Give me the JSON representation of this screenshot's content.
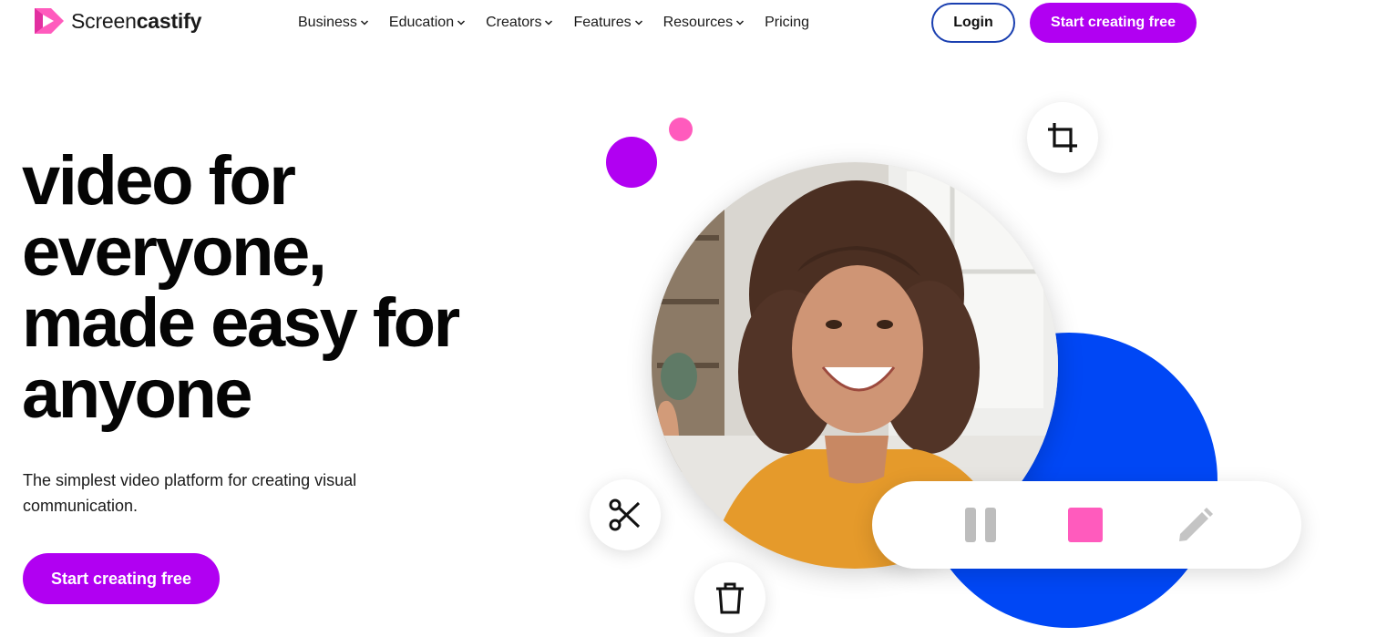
{
  "header": {
    "logo": {
      "text_light": "Screen",
      "text_bold": "castify"
    },
    "nav": [
      {
        "label": "Business",
        "has_dropdown": true
      },
      {
        "label": "Education",
        "has_dropdown": true
      },
      {
        "label": "Creators",
        "has_dropdown": true
      },
      {
        "label": "Features",
        "has_dropdown": true
      },
      {
        "label": "Resources",
        "has_dropdown": true
      },
      {
        "label": "Pricing",
        "has_dropdown": false
      }
    ],
    "login_label": "Login",
    "cta_label": "Start creating free"
  },
  "hero": {
    "headline_lines": [
      "video for",
      "everyone,",
      "made easy for",
      "anyone"
    ],
    "subtext": "The simplest video platform for creating visual communication.",
    "cta_label": "Start creating free"
  },
  "recorder": {
    "icons": [
      "crop-icon",
      "scissors-icon",
      "trash-icon",
      "pause-icon",
      "stop-icon",
      "pencil-icon"
    ]
  },
  "colors": {
    "brand_purple": "#b100f2",
    "accent_pink": "#ff5bbd",
    "accent_blue": "#0047f5",
    "login_border": "#1a3fb0"
  }
}
